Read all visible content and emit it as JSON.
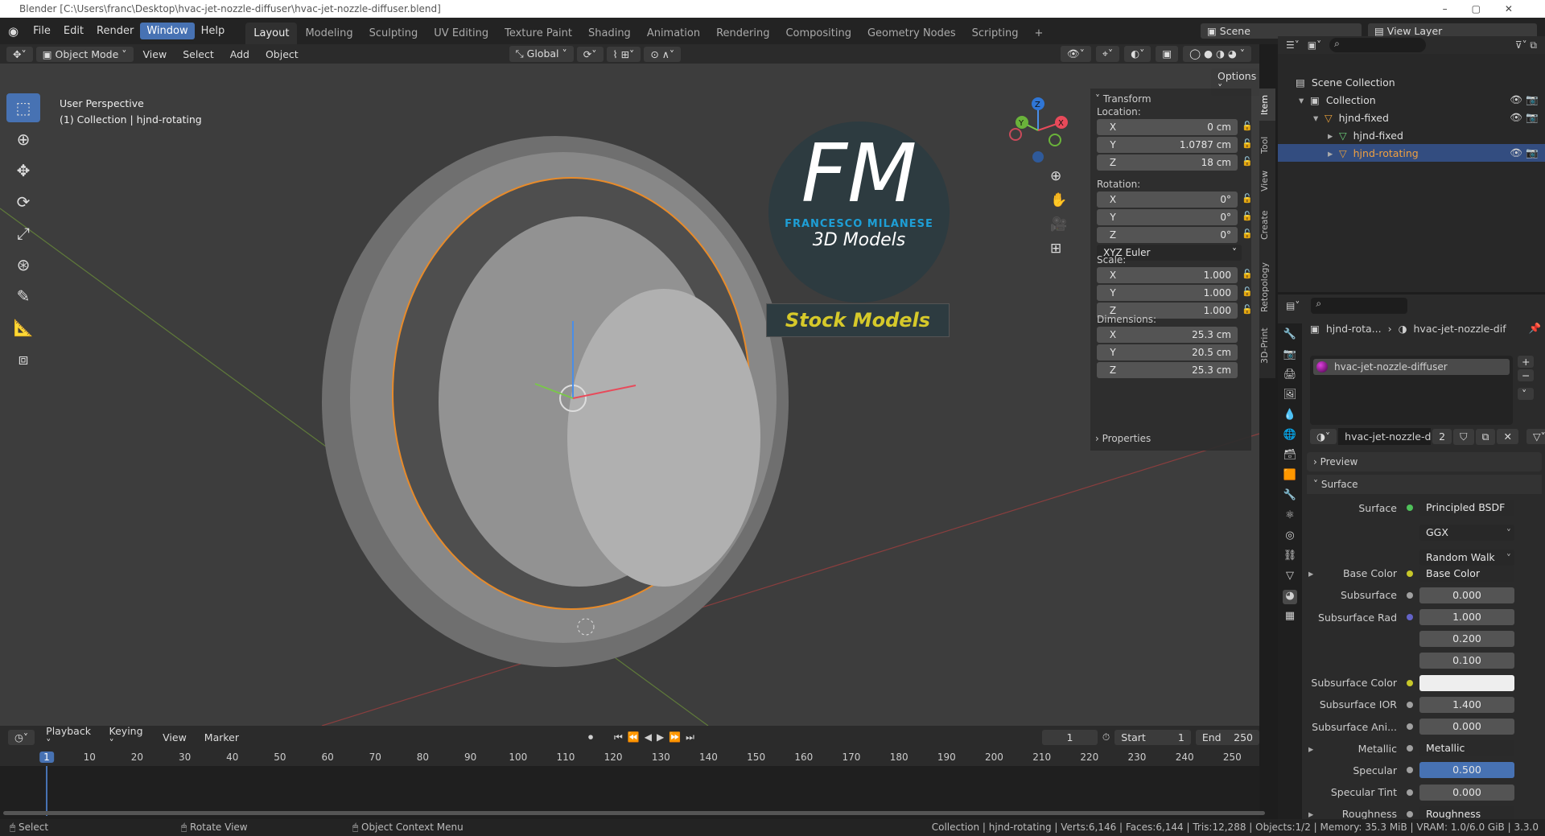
{
  "window": {
    "title": "Blender [C:\\Users\\franc\\Desktop\\hvac-jet-nozzle-diffuser\\hvac-jet-nozzle-diffuser.blend]"
  },
  "menus": [
    "File",
    "Edit",
    "Render",
    "Window",
    "Help"
  ],
  "workspaces": [
    "Layout",
    "Modeling",
    "Sculpting",
    "UV Editing",
    "Texture Paint",
    "Shading",
    "Animation",
    "Rendering",
    "Compositing",
    "Geometry Nodes",
    "Scripting",
    "+"
  ],
  "scene": "Scene",
  "view_layer": "View Layer",
  "header": {
    "mode": "Object Mode",
    "items": [
      "View",
      "Select",
      "Add",
      "Object"
    ],
    "orientation": "Global",
    "options": "Options"
  },
  "viewport": {
    "perspective": "User Perspective",
    "collection_info": "(1) Collection | hjnd-rotating",
    "logo": {
      "letters": "FM",
      "name": "FRANCESCO MILANESE",
      "sub": "3D Models",
      "banner": "Stock Models"
    },
    "gizmo": [
      "X",
      "Y",
      "Z"
    ]
  },
  "npanel": {
    "tabs": [
      "Item",
      "Tool",
      "View",
      "Create",
      "Retopology",
      "3D-Print"
    ],
    "transform": "Transform",
    "location_label": "Location:",
    "location": [
      [
        "X",
        "0 cm"
      ],
      [
        "Y",
        "1.0787 cm"
      ],
      [
        "Z",
        "18 cm"
      ]
    ],
    "rotation_label": "Rotation:",
    "rotation": [
      [
        "X",
        "0°"
      ],
      [
        "Y",
        "0°"
      ],
      [
        "Z",
        "0°"
      ]
    ],
    "rotation_mode": "XYZ Euler",
    "scale_label": "Scale:",
    "scale": [
      [
        "X",
        "1.000"
      ],
      [
        "Y",
        "1.000"
      ],
      [
        "Z",
        "1.000"
      ]
    ],
    "dimensions_label": "Dimensions:",
    "dimensions": [
      [
        "X",
        "25.3 cm"
      ],
      [
        "Y",
        "20.5 cm"
      ],
      [
        "Z",
        "25.3 cm"
      ]
    ],
    "properties": "Properties"
  },
  "outliner": {
    "items": [
      {
        "label": "Scene Collection"
      },
      {
        "label": "Collection"
      },
      {
        "label": "hjnd-fixed"
      },
      {
        "label": "hjnd-fixed"
      },
      {
        "label": "hjnd-rotating"
      }
    ]
  },
  "properties": {
    "breadcrumb_object": "hjnd-rota...",
    "breadcrumb_material": "hvac-jet-nozzle-dif",
    "slot": "hvac-jet-nozzle-diffuser",
    "material_name": "hvac-jet-nozzle-d...",
    "users": "2",
    "preview": "Preview",
    "surface_panel": "Surface",
    "rows": [
      {
        "label": "Surface",
        "value": "Principled BSDF",
        "kind": "lnk",
        "dot": "#4fc15a"
      },
      {
        "label": "",
        "value": "GGX",
        "kind": "drop"
      },
      {
        "label": "",
        "value": "Random Walk",
        "kind": "drop"
      },
      {
        "label": "Base Color",
        "value": "Base Color",
        "kind": "lnk",
        "dot": "#c7c729",
        "expand": true
      },
      {
        "label": "Subsurface",
        "value": "0.000",
        "kind": "num",
        "dot": "#a0a0a0"
      },
      {
        "label": "Subsurface Rad",
        "value": "1.000",
        "kind": "num",
        "dot": "#6363c7"
      },
      {
        "label": "",
        "value": "0.200",
        "kind": "num"
      },
      {
        "label": "",
        "value": "0.100",
        "kind": "num"
      },
      {
        "label": "Subsurface Color",
        "value": "",
        "kind": "white",
        "dot": "#c7c729"
      },
      {
        "label": "Subsurface IOR",
        "value": "1.400",
        "kind": "num",
        "dot": "#a0a0a0"
      },
      {
        "label": "Subsurface Ani...",
        "value": "0.000",
        "kind": "num",
        "dot": "#a0a0a0"
      },
      {
        "label": "Metallic",
        "value": "Metallic",
        "kind": "lnk",
        "dot": "#a0a0a0",
        "expand": true
      },
      {
        "label": "Specular",
        "value": "0.500",
        "kind": "blue",
        "dot": "#a0a0a0"
      },
      {
        "label": "Specular Tint",
        "value": "0.000",
        "kind": "num",
        "dot": "#a0a0a0"
      },
      {
        "label": "Roughness",
        "value": "Roughness",
        "kind": "lnk",
        "dot": "#a0a0a0",
        "expand": true
      }
    ]
  },
  "timeline": {
    "menus": [
      "Playback",
      "Keying",
      "View",
      "Marker"
    ],
    "current_frame": "1",
    "start_label": "Start",
    "start": "1",
    "end_label": "End",
    "end": "250",
    "ticks": [
      "1",
      "10",
      "20",
      "30",
      "40",
      "50",
      "60",
      "70",
      "80",
      "90",
      "100",
      "110",
      "120",
      "130",
      "140",
      "150",
      "160",
      "170",
      "180",
      "190",
      "200",
      "210",
      "220",
      "230",
      "240",
      "250"
    ]
  },
  "status": {
    "select": "Select",
    "rotate": "Rotate View",
    "context": "Object Context Menu",
    "info": "Collection | hjnd-rotating | Verts:6,146 | Faces:6,144 | Tris:12,288 | Objects:1/2 | Memory: 35.3 MiB | VRAM: 1.0/6.0 GiB | 3.3.0"
  }
}
